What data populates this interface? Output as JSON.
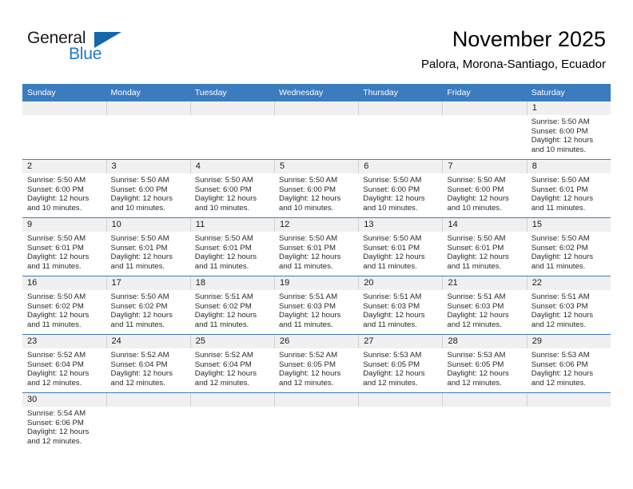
{
  "brand": {
    "name_top": "General",
    "name_bottom": "Blue",
    "triangle_color": "#1467ab",
    "blue_text_color": "#1f7ac4"
  },
  "header": {
    "title": "November 2025",
    "subtitle": "Palora, Morona-Santiago, Ecuador",
    "accent_color": "#3b7cbf"
  },
  "weekdays": [
    "Sunday",
    "Monday",
    "Tuesday",
    "Wednesday",
    "Thursday",
    "Friday",
    "Saturday"
  ],
  "weeks": [
    [
      {
        "day": "",
        "empty": true
      },
      {
        "day": "",
        "empty": true
      },
      {
        "day": "",
        "empty": true
      },
      {
        "day": "",
        "empty": true
      },
      {
        "day": "",
        "empty": true
      },
      {
        "day": "",
        "empty": true
      },
      {
        "day": "1",
        "sunrise": "Sunrise: 5:50 AM",
        "sunset": "Sunset: 6:00 PM",
        "daylight_1": "Daylight: 12 hours",
        "daylight_2": "and 10 minutes."
      }
    ],
    [
      {
        "day": "2",
        "sunrise": "Sunrise: 5:50 AM",
        "sunset": "Sunset: 6:00 PM",
        "daylight_1": "Daylight: 12 hours",
        "daylight_2": "and 10 minutes."
      },
      {
        "day": "3",
        "sunrise": "Sunrise: 5:50 AM",
        "sunset": "Sunset: 6:00 PM",
        "daylight_1": "Daylight: 12 hours",
        "daylight_2": "and 10 minutes."
      },
      {
        "day": "4",
        "sunrise": "Sunrise: 5:50 AM",
        "sunset": "Sunset: 6:00 PM",
        "daylight_1": "Daylight: 12 hours",
        "daylight_2": "and 10 minutes."
      },
      {
        "day": "5",
        "sunrise": "Sunrise: 5:50 AM",
        "sunset": "Sunset: 6:00 PM",
        "daylight_1": "Daylight: 12 hours",
        "daylight_2": "and 10 minutes."
      },
      {
        "day": "6",
        "sunrise": "Sunrise: 5:50 AM",
        "sunset": "Sunset: 6:00 PM",
        "daylight_1": "Daylight: 12 hours",
        "daylight_2": "and 10 minutes."
      },
      {
        "day": "7",
        "sunrise": "Sunrise: 5:50 AM",
        "sunset": "Sunset: 6:00 PM",
        "daylight_1": "Daylight: 12 hours",
        "daylight_2": "and 10 minutes."
      },
      {
        "day": "8",
        "sunrise": "Sunrise: 5:50 AM",
        "sunset": "Sunset: 6:01 PM",
        "daylight_1": "Daylight: 12 hours",
        "daylight_2": "and 11 minutes."
      }
    ],
    [
      {
        "day": "9",
        "sunrise": "Sunrise: 5:50 AM",
        "sunset": "Sunset: 6:01 PM",
        "daylight_1": "Daylight: 12 hours",
        "daylight_2": "and 11 minutes."
      },
      {
        "day": "10",
        "sunrise": "Sunrise: 5:50 AM",
        "sunset": "Sunset: 6:01 PM",
        "daylight_1": "Daylight: 12 hours",
        "daylight_2": "and 11 minutes."
      },
      {
        "day": "11",
        "sunrise": "Sunrise: 5:50 AM",
        "sunset": "Sunset: 6:01 PM",
        "daylight_1": "Daylight: 12 hours",
        "daylight_2": "and 11 minutes."
      },
      {
        "day": "12",
        "sunrise": "Sunrise: 5:50 AM",
        "sunset": "Sunset: 6:01 PM",
        "daylight_1": "Daylight: 12 hours",
        "daylight_2": "and 11 minutes."
      },
      {
        "day": "13",
        "sunrise": "Sunrise: 5:50 AM",
        "sunset": "Sunset: 6:01 PM",
        "daylight_1": "Daylight: 12 hours",
        "daylight_2": "and 11 minutes."
      },
      {
        "day": "14",
        "sunrise": "Sunrise: 5:50 AM",
        "sunset": "Sunset: 6:01 PM",
        "daylight_1": "Daylight: 12 hours",
        "daylight_2": "and 11 minutes."
      },
      {
        "day": "15",
        "sunrise": "Sunrise: 5:50 AM",
        "sunset": "Sunset: 6:02 PM",
        "daylight_1": "Daylight: 12 hours",
        "daylight_2": "and 11 minutes."
      }
    ],
    [
      {
        "day": "16",
        "sunrise": "Sunrise: 5:50 AM",
        "sunset": "Sunset: 6:02 PM",
        "daylight_1": "Daylight: 12 hours",
        "daylight_2": "and 11 minutes."
      },
      {
        "day": "17",
        "sunrise": "Sunrise: 5:50 AM",
        "sunset": "Sunset: 6:02 PM",
        "daylight_1": "Daylight: 12 hours",
        "daylight_2": "and 11 minutes."
      },
      {
        "day": "18",
        "sunrise": "Sunrise: 5:51 AM",
        "sunset": "Sunset: 6:02 PM",
        "daylight_1": "Daylight: 12 hours",
        "daylight_2": "and 11 minutes."
      },
      {
        "day": "19",
        "sunrise": "Sunrise: 5:51 AM",
        "sunset": "Sunset: 6:03 PM",
        "daylight_1": "Daylight: 12 hours",
        "daylight_2": "and 11 minutes."
      },
      {
        "day": "20",
        "sunrise": "Sunrise: 5:51 AM",
        "sunset": "Sunset: 6:03 PM",
        "daylight_1": "Daylight: 12 hours",
        "daylight_2": "and 11 minutes."
      },
      {
        "day": "21",
        "sunrise": "Sunrise: 5:51 AM",
        "sunset": "Sunset: 6:03 PM",
        "daylight_1": "Daylight: 12 hours",
        "daylight_2": "and 12 minutes."
      },
      {
        "day": "22",
        "sunrise": "Sunrise: 5:51 AM",
        "sunset": "Sunset: 6:03 PM",
        "daylight_1": "Daylight: 12 hours",
        "daylight_2": "and 12 minutes."
      }
    ],
    [
      {
        "day": "23",
        "sunrise": "Sunrise: 5:52 AM",
        "sunset": "Sunset: 6:04 PM",
        "daylight_1": "Daylight: 12 hours",
        "daylight_2": "and 12 minutes."
      },
      {
        "day": "24",
        "sunrise": "Sunrise: 5:52 AM",
        "sunset": "Sunset: 6:04 PM",
        "daylight_1": "Daylight: 12 hours",
        "daylight_2": "and 12 minutes."
      },
      {
        "day": "25",
        "sunrise": "Sunrise: 5:52 AM",
        "sunset": "Sunset: 6:04 PM",
        "daylight_1": "Daylight: 12 hours",
        "daylight_2": "and 12 minutes."
      },
      {
        "day": "26",
        "sunrise": "Sunrise: 5:52 AM",
        "sunset": "Sunset: 6:05 PM",
        "daylight_1": "Daylight: 12 hours",
        "daylight_2": "and 12 minutes."
      },
      {
        "day": "27",
        "sunrise": "Sunrise: 5:53 AM",
        "sunset": "Sunset: 6:05 PM",
        "daylight_1": "Daylight: 12 hours",
        "daylight_2": "and 12 minutes."
      },
      {
        "day": "28",
        "sunrise": "Sunrise: 5:53 AM",
        "sunset": "Sunset: 6:05 PM",
        "daylight_1": "Daylight: 12 hours",
        "daylight_2": "and 12 minutes."
      },
      {
        "day": "29",
        "sunrise": "Sunrise: 5:53 AM",
        "sunset": "Sunset: 6:06 PM",
        "daylight_1": "Daylight: 12 hours",
        "daylight_2": "and 12 minutes."
      }
    ],
    [
      {
        "day": "30",
        "sunrise": "Sunrise: 5:54 AM",
        "sunset": "Sunset: 6:06 PM",
        "daylight_1": "Daylight: 12 hours",
        "daylight_2": "and 12 minutes."
      },
      {
        "day": "",
        "empty": true
      },
      {
        "day": "",
        "empty": true
      },
      {
        "day": "",
        "empty": true
      },
      {
        "day": "",
        "empty": true
      },
      {
        "day": "",
        "empty": true
      },
      {
        "day": "",
        "empty": true
      }
    ]
  ]
}
